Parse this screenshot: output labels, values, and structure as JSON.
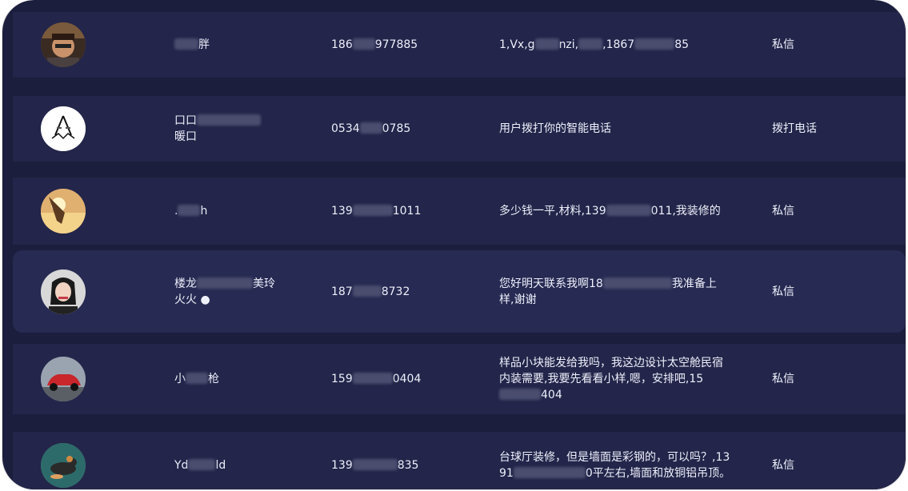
{
  "records": [
    {
      "avatar_icon": "man-portrait-avatar",
      "name_line1_a": "",
      "name_line1_b": "胖",
      "name_line2": "",
      "phone_a": "186",
      "phone_b": "977885",
      "message_a": "1,Vx,g",
      "message_b": "nzi,",
      "message_c": ",1867",
      "message_d": "85",
      "action": "私信"
    },
    {
      "avatar_icon": "logo-avatar",
      "name_line1_a": "",
      "name_line1_b": "",
      "name_line2": "暖口",
      "phone_a": "0534",
      "phone_b": "0785",
      "message_a": "用户拨打你的智能电话",
      "message_b": "",
      "message_c": "",
      "message_d": "",
      "action": "拨打电话"
    },
    {
      "avatar_icon": "sunset-avatar",
      "name_line1_a": ".",
      "name_line1_b": "h",
      "name_line2": "",
      "phone_a": "139",
      "phone_b": "1011",
      "message_a": "多少钱一平,材料,139",
      "message_b": "011,我装修的",
      "message_c": "",
      "message_d": "",
      "action": "私信"
    },
    {
      "avatar_icon": "woman-portrait-avatar",
      "name_line1_a": "楼龙",
      "name_line1_b": "美玲",
      "name_line2": "火火",
      "phone_a": "187",
      "phone_b": "8732",
      "message_a": "您好明天联系我啊18",
      "message_b": "我准备上样,谢谢",
      "message_c": "",
      "message_d": "",
      "action": "私信"
    },
    {
      "avatar_icon": "red-car-avatar",
      "name_line1_a": "小",
      "name_line1_b": "枪",
      "name_line2": "",
      "phone_a": "159",
      "phone_b": "0404",
      "message_a": "样品小块能发给我吗，我这边设计太空舱民宿内装需要,我要先看看小样,嗯，安排吧,15",
      "message_b": "404",
      "message_c": "",
      "message_d": "",
      "action": "私信"
    },
    {
      "avatar_icon": "turtle-avatar",
      "name_line1_a": "Yd",
      "name_line1_b": "ld",
      "name_line2": "",
      "phone_a": "139",
      "phone_b": "835",
      "message_a": "台球厅装修，但是墙面是彩钢的，可以吗？,1391",
      "message_b": "0平左右,墙面和放铜铝吊顶。",
      "message_c": "",
      "message_d": "",
      "action": "私信"
    }
  ]
}
